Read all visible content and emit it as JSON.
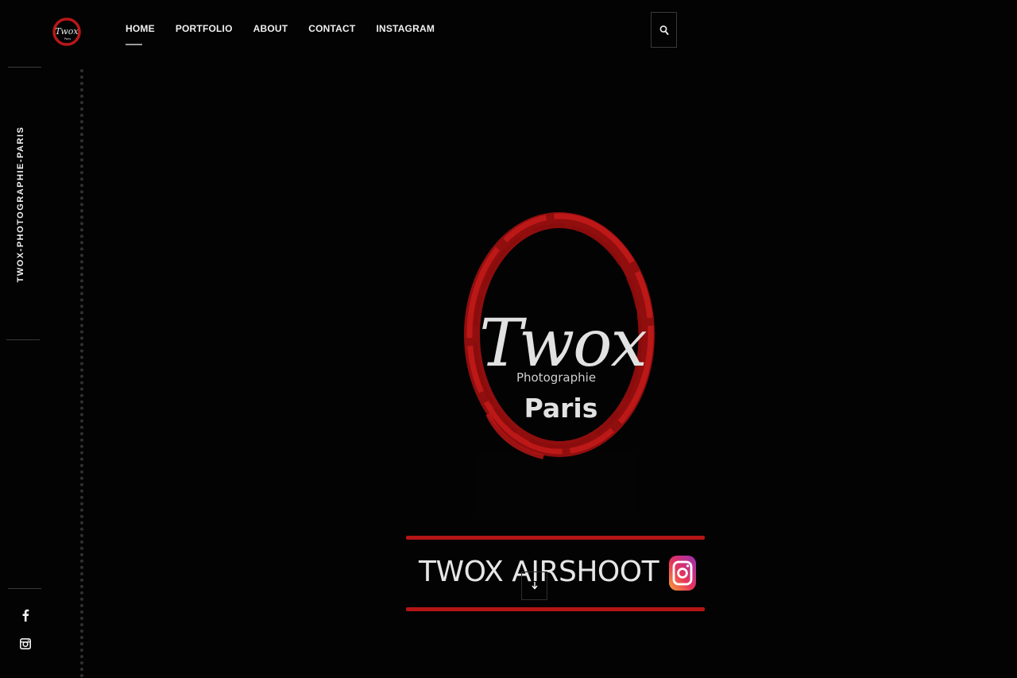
{
  "brand": {
    "logo_text": "Twox",
    "logo_subtext": "Photographie",
    "logo_city": "Paris",
    "side_title": "TWOX-PHOTOGRAPHIE-PARIS",
    "accent_color": "#c01818"
  },
  "nav": {
    "items": [
      {
        "label": "HOME",
        "active": true
      },
      {
        "label": "PORTFOLIO",
        "active": false
      },
      {
        "label": "ABOUT",
        "active": false
      },
      {
        "label": "CONTACT",
        "active": false
      },
      {
        "label": "INSTAGRAM",
        "active": false
      }
    ]
  },
  "header": {
    "search_icon": "search-icon"
  },
  "hero": {
    "banner_text": "TWOX AIRSHOOT",
    "banner_icon": "instagram-icon",
    "scroll_icon": "chevron-down-icon"
  },
  "social": {
    "items": [
      "facebook-icon",
      "instagram-icon"
    ]
  }
}
